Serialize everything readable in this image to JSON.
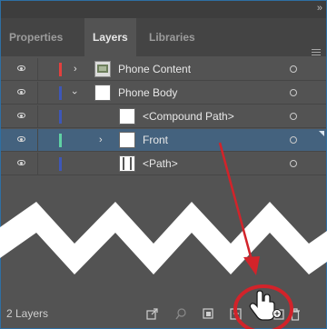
{
  "tabs": [
    {
      "label": "Properties",
      "active": false
    },
    {
      "label": "Layers",
      "active": true
    },
    {
      "label": "Libraries",
      "active": false
    }
  ],
  "layers": [
    {
      "name": "Phone Content",
      "indent": 0,
      "expanded": false,
      "color": "#e3403e",
      "thumbnail": "phone-content-thumbnail",
      "selected": false
    },
    {
      "name": "Phone Body",
      "indent": 0,
      "expanded": true,
      "color": "#3e57b8",
      "thumbnail": "white-square-thumbnail",
      "selected": false
    },
    {
      "name": "<Compound Path>",
      "indent": 1,
      "expanded": null,
      "color": "#3e57b8",
      "thumbnail": "white-square-thumbnail",
      "selected": false
    },
    {
      "name": "Front",
      "indent": 1,
      "expanded": false,
      "color": "#5fd1a4",
      "thumbnail": "white-square-thumbnail",
      "selected": true
    },
    {
      "name": "<Path>",
      "indent": 1,
      "expanded": null,
      "color": "#3e57b8",
      "thumbnail": "path-thumbnail",
      "selected": false
    }
  ],
  "footer": {
    "layer_count": "2 Layers",
    "icons": [
      "collect-for-export-icon",
      "locate-object-icon",
      "make-clipping-mask-icon",
      "create-sublayer-icon",
      "create-new-layer-icon",
      "delete-icon"
    ]
  },
  "annotation": {
    "arrow_color": "#d2232a",
    "cursor": "hand-cursor-with-plus-icon"
  },
  "colors": {
    "panel_bg": "#535353",
    "selected_row": "#44627e",
    "panel_border": "#2e6fa3"
  }
}
